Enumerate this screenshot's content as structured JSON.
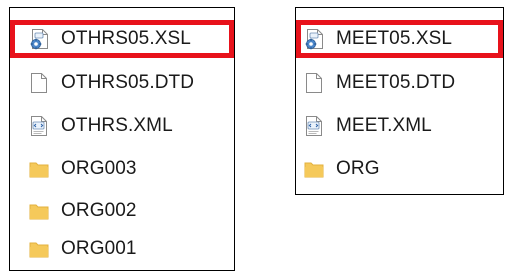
{
  "colors": {
    "selection_border": "#e8121b",
    "folder": "#f5c95a",
    "folder_dark": "#e3b13d"
  },
  "left_panel": {
    "items": [
      {
        "label": "OTHRS05.XSL",
        "icon": "xsl-file-icon",
        "selected": true
      },
      {
        "label": "OTHRS05.DTD",
        "icon": "blank-file-icon",
        "selected": false
      },
      {
        "label": "OTHRS.XML",
        "icon": "xml-file-icon",
        "selected": false
      },
      {
        "label": "ORG003",
        "icon": "folder-icon",
        "selected": false
      },
      {
        "label": "ORG002",
        "icon": "folder-icon",
        "selected": false
      },
      {
        "label": "ORG001",
        "icon": "folder-icon",
        "selected": false
      }
    ]
  },
  "right_panel": {
    "items": [
      {
        "label": "MEET05.XSL",
        "icon": "xsl-file-icon",
        "selected": true
      },
      {
        "label": "MEET05.DTD",
        "icon": "blank-file-icon",
        "selected": false
      },
      {
        "label": "MEET.XML",
        "icon": "xml-file-icon",
        "selected": false
      },
      {
        "label": "ORG",
        "icon": "folder-icon",
        "selected": false
      }
    ]
  }
}
